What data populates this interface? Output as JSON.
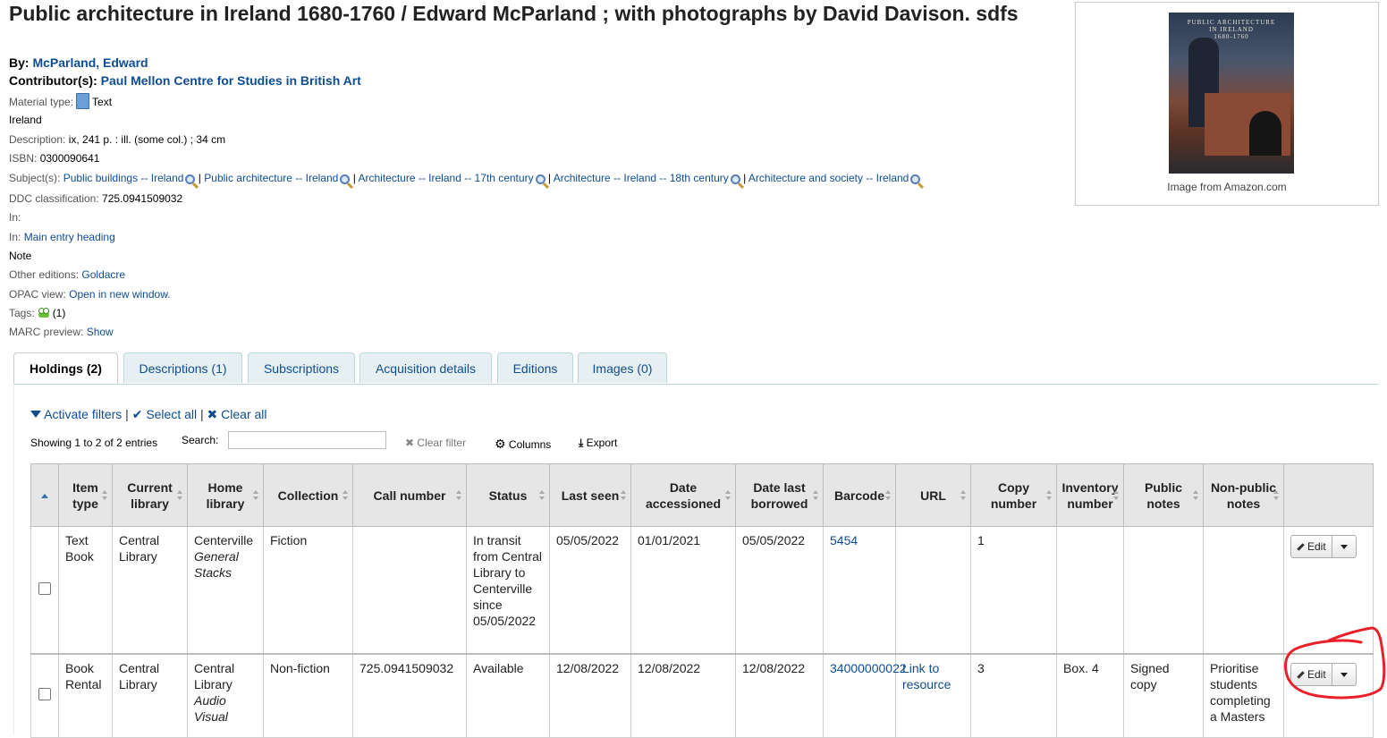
{
  "title": "Public architecture in Ireland 1680-1760 / Edward McParland ; with photographs by David Davison. sdfs",
  "by": {
    "label": "By:",
    "value": "McParland, Edward"
  },
  "contributor": {
    "label": "Contributor(s):",
    "value": "Paul Mellon Centre for Studies in British Art"
  },
  "material": {
    "label": "Material type:",
    "value": "Text",
    "icon": "book-icon"
  },
  "place": "Ireland",
  "description": {
    "label": "Description:",
    "value": "ix, 241 p. : ill. (some col.) ; 34 cm"
  },
  "isbn": {
    "label": "ISBN:",
    "value": "0300090641"
  },
  "subjects": {
    "label": "Subject(s):",
    "items": [
      "Public buildings -- Ireland",
      "Public architecture -- Ireland",
      "Architecture -- Ireland -- 17th century",
      "Architecture -- Ireland -- 18th century",
      "Architecture and society -- Ireland"
    ]
  },
  "ddc": {
    "label": "DDC classification:",
    "value": "725.0941509032"
  },
  "in1": {
    "label": "In:"
  },
  "in2": {
    "label": "In:",
    "value": "Main entry heading"
  },
  "note": "Note",
  "editions": {
    "label": "Other editions:",
    "value": "Goldacre"
  },
  "opac": {
    "label": "OPAC view:",
    "value": "Open in new window."
  },
  "tags": {
    "label": "Tags:",
    "value": "(1)"
  },
  "marc": {
    "label": "MARC preview:",
    "value": "Show"
  },
  "cover": {
    "caption": "Image from Amazon.com",
    "title_line1": "PUBLIC ARCHITECTURE",
    "title_line2": "IN IRELAND",
    "title_line3": "1680-1760"
  },
  "tabs": [
    "Holdings (2)",
    "Descriptions (1)",
    "Subscriptions",
    "Acquisition details",
    "Editions",
    "Images (0)"
  ],
  "filters": {
    "activate": "Activate filters",
    "select_all": "Select all",
    "clear_all": "Clear all",
    "sep": "|"
  },
  "toolbar": {
    "showing": "Showing 1 to 2 of 2 entries",
    "search": "Search:",
    "clear_filter": "Clear filter",
    "columns": "Columns",
    "export": "Export"
  },
  "columns": [
    "Item type",
    "Current library",
    "Home library",
    "Collection",
    "Call number",
    "Status",
    "Last seen",
    "Date accessioned",
    "Date last borrowed",
    "Barcode",
    "URL",
    "Copy number",
    "Inventory number",
    "Public notes",
    "Non-public notes"
  ],
  "rows": [
    {
      "item_type": "Text Book",
      "current_library": "Central Library",
      "home_library": "Centerville",
      "home_location": "General Stacks",
      "collection": "Fiction",
      "call_number": "",
      "status": "In transit from Central Library to Centerville since 05/05/2022",
      "last_seen": "05/05/2022",
      "date_accessioned": "01/01/2021",
      "date_last_borrowed": "05/05/2022",
      "barcode": "5454",
      "url": "",
      "copy_number": "1",
      "inventory_number": "",
      "public_notes": "",
      "nonpublic_notes": "",
      "edit": "Edit"
    },
    {
      "item_type": "Book Rental",
      "current_library": "Central Library",
      "home_library": "Central Library",
      "home_location": "Audio Visual",
      "collection": "Non-fiction",
      "call_number": "725.0941509032",
      "status": "Available",
      "last_seen": "12/08/2022",
      "date_accessioned": "12/08/2022",
      "date_last_borrowed": "12/08/2022",
      "barcode": "34000000022",
      "url": "Link to resource",
      "copy_number": "3",
      "inventory_number": "Box. 4",
      "public_notes": "Signed copy",
      "nonpublic_notes": "Prioritise students completing a Masters",
      "edit": "Edit"
    }
  ],
  "colors": {
    "link": "#0f4d92",
    "header_bg": "#e6e6e6",
    "tab_bg": "#e6f0f2",
    "annotation": "#e8202a"
  }
}
